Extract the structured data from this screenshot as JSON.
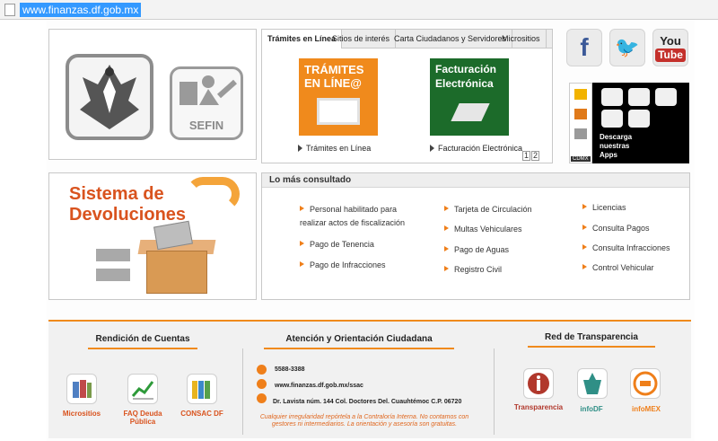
{
  "browser": {
    "url": "www.finanzas.df.gob.mx"
  },
  "logos": {
    "sefin": "SEFIN"
  },
  "tabs": [
    {
      "label": "Trámites en Línea"
    },
    {
      "label": "Sitios de interés"
    },
    {
      "label": "Carta Ciudadanos y Servidores"
    },
    {
      "label": "Micrositios"
    }
  ],
  "promos": [
    {
      "image_text": "TRÁMITES EN LÍNE@",
      "link": "Trámites en Línea"
    },
    {
      "image_text": "Facturación Electrónica",
      "link": "Facturación Electrónica"
    }
  ],
  "pager": [
    "1",
    "2"
  ],
  "social": {
    "youtube_you": "You",
    "youtube_tube": "Tube"
  },
  "apps_banner": {
    "text": "Descarga nuestras Apps",
    "badge": "CDMX"
  },
  "devoluciones": {
    "title": "Sistema de Devoluciones"
  },
  "mas_consultado": {
    "title": "Lo más consultado",
    "col1": [
      "Personal habilitado para realizar actos de fiscalización",
      "Pago de Tenencia",
      "Pago de Infracciones"
    ],
    "col2": [
      "Tarjeta de Circulación",
      "Multas Vehiculares",
      "Pago de Aguas",
      "Registro Civil"
    ],
    "col3": [
      "Licencias",
      "Consulta Pagos",
      "Consulta Infracciones",
      "Control Vehicular"
    ]
  },
  "footer": {
    "rendicion": {
      "title": "Rendición de Cuentas",
      "items": [
        "Micrositios",
        "FAQ Deuda Pública",
        "CONSAC DF"
      ]
    },
    "atencion": {
      "title": "Atención y Orientación Ciudadana",
      "phone": "5588-3388",
      "web": "www.finanzas.df.gob.mx/ssac",
      "address": "Dr. Lavista núm. 144 Col. Doctores Del. Cuauhtémoc C.P. 06720",
      "note": "Cualquier irregularidad repórtela a la Contraloría Interna. No contamos con gestores ni intermediarios. La orientación y asesoría son gratuitas."
    },
    "transparencia": {
      "title": "Red de Transparencia",
      "items": [
        "Transparencia",
        "infoDF",
        "infoMEX"
      ]
    }
  },
  "colors": {
    "accent": "#f08a1c",
    "title_orange": "#d9531e"
  }
}
